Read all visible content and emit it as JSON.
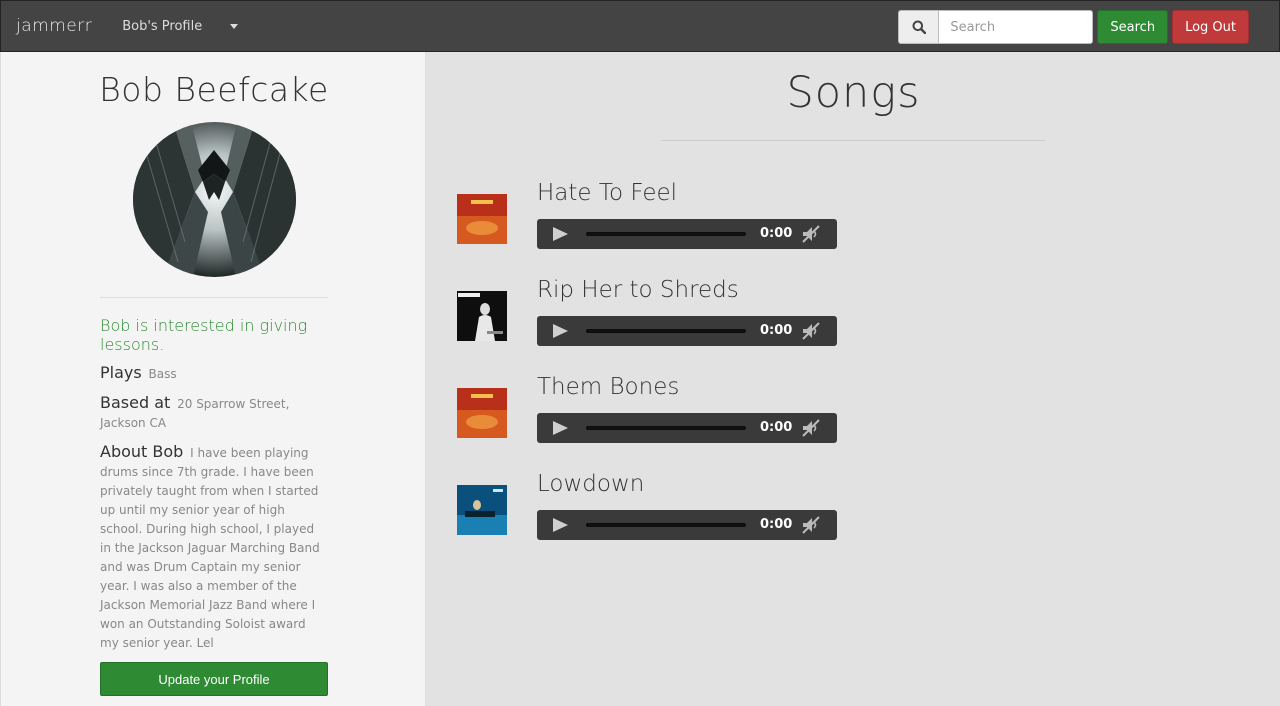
{
  "navbar": {
    "brand": "jammerr",
    "profile_menu": "Bob's Profile",
    "search_placeholder": "Search",
    "search_button": "Search",
    "logout_button": "Log Out"
  },
  "profile": {
    "name": "Bob Beefcake",
    "lessons_note": "Bob is interested in giving lessons.",
    "plays_label": "Plays",
    "plays_value": "Bass",
    "based_label": "Based at",
    "based_value": "20 Sparrow Street, Jackson CA",
    "about_label": "About Bob",
    "about_value": "I have been playing drums since 7th grade. I have been privately taught from when I started up until my senior year of high school. During high school, I played in the Jackson Jaguar Marching Band and was Drum Captain my senior year. I was also a member of the Jackson Memorial Jazz Band where I won an Outstanding Soloist award my senior year. Lel",
    "update_button": "Update your Profile"
  },
  "songs": {
    "title": "Songs",
    "items": [
      {
        "title": "Hate To Feel",
        "time": "0:00",
        "art_colors": [
          "#c4341c",
          "#e87a2a"
        ]
      },
      {
        "title": "Rip Her to Shreds",
        "time": "0:00",
        "art_colors": [
          "#111111",
          "#e5e5e5"
        ]
      },
      {
        "title": "Them Bones",
        "time": "0:00",
        "art_colors": [
          "#c4341c",
          "#e87a2a"
        ]
      },
      {
        "title": "Lowdown",
        "time": "0:00",
        "art_colors": [
          "#0d5b8c",
          "#2a8ec0"
        ]
      }
    ]
  }
}
